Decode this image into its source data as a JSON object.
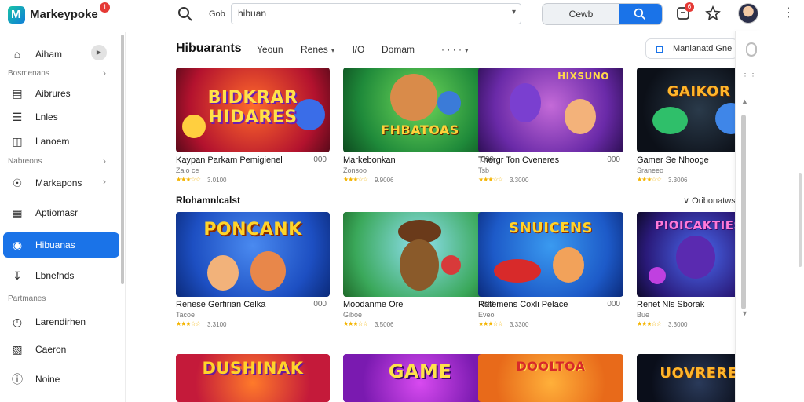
{
  "app": {
    "brand": "Markeypoke",
    "brand_badge": "1"
  },
  "search": {
    "scope": "Gob",
    "placeholder": "hibuan",
    "button_label": "Cewb"
  },
  "header": {
    "notifications_badge": "6"
  },
  "sidebar": {
    "items": [
      {
        "label": "Aiham",
        "icon": "home-icon"
      },
      {
        "section": "Bosmenans"
      },
      {
        "label": "Aibrures",
        "icon": "library-icon"
      },
      {
        "label": "Lnles",
        "icon": "list-icon"
      },
      {
        "label": "Lanoem",
        "icon": "columns-icon"
      },
      {
        "section": "Nabreons"
      },
      {
        "label": "Markapons",
        "icon": "compass-icon"
      },
      {
        "label": "Aptiomasr",
        "icon": "apps-icon"
      },
      {
        "label": "Hibuanas",
        "icon": "globe-icon",
        "active": true
      },
      {
        "label": "Lbnefnds",
        "icon": "download-icon"
      },
      {
        "section": "Partmanes"
      },
      {
        "label": "Larendirhen",
        "icon": "clock-icon"
      },
      {
        "label": "Caeron",
        "icon": "card-icon"
      },
      {
        "label": "Noine",
        "icon": "info-icon"
      }
    ]
  },
  "main": {
    "title": "Hibuarants",
    "filters": [
      "Yeoun",
      "Renes",
      "l/O",
      "Domam",
      "· · · ·"
    ],
    "sort_label": "Manlanatd Gne",
    "section_label": "Rlohamnlcalst",
    "section_link": "Oribonatws",
    "row1": [
      {
        "art_title": "BIDKRAR HIDARES",
        "name": "Kaypan Parkam Pemigienel",
        "count": "000",
        "sub": "Zalo ce",
        "rating": "3.0100",
        "stars": "★★★☆☆"
      },
      {
        "art_title": "FHBATOAS",
        "name": "Markebonkan",
        "count": "000",
        "sub": "Zonsoo",
        "rating": "9.9006",
        "stars": "★★★☆☆"
      },
      {
        "art_title": "HIXSUNO",
        "name": "Thergr Ton Cveneres",
        "count": "000",
        "sub": "Tsb",
        "rating": "3.3000",
        "stars": "★★★☆☆"
      },
      {
        "art_title": "GAIKOR",
        "name": "Gamer Se Nhooge",
        "count": "",
        "sub": "Sraneeo",
        "rating": "3.3006",
        "stars": "★★★☆☆"
      }
    ],
    "row2": [
      {
        "art_title": "PONCANK",
        "name": "Renese Gerfirian Celka",
        "count": "000",
        "sub": "Tacoe",
        "rating": "3.3100",
        "stars": "★★★☆☆"
      },
      {
        "art_title": "",
        "name": "Moodanme Ore",
        "count": "009",
        "sub": "Giboe",
        "rating": "3.5006",
        "stars": "★★★☆☆"
      },
      {
        "art_title": "SNUICENS",
        "name": "Ratemens Coxli Pelace",
        "count": "000",
        "sub": "Eveo",
        "rating": "3.3300",
        "stars": "★★★☆☆"
      },
      {
        "art_title": "PIOICAKTIES",
        "name": "Renet Nls Sborak",
        "count": "",
        "sub": "Bue",
        "rating": "3.3000",
        "stars": "★★★☆☆"
      }
    ],
    "row3": [
      {
        "art_title": "DUSHINAK"
      },
      {
        "art_title": "GAME"
      },
      {
        "art_title": "DOOLTOA"
      },
      {
        "art_title": "UOVRERE"
      }
    ]
  },
  "colors": {
    "accent": "#1a73e8",
    "badge": "#e53935",
    "stars": "#f4b400"
  }
}
